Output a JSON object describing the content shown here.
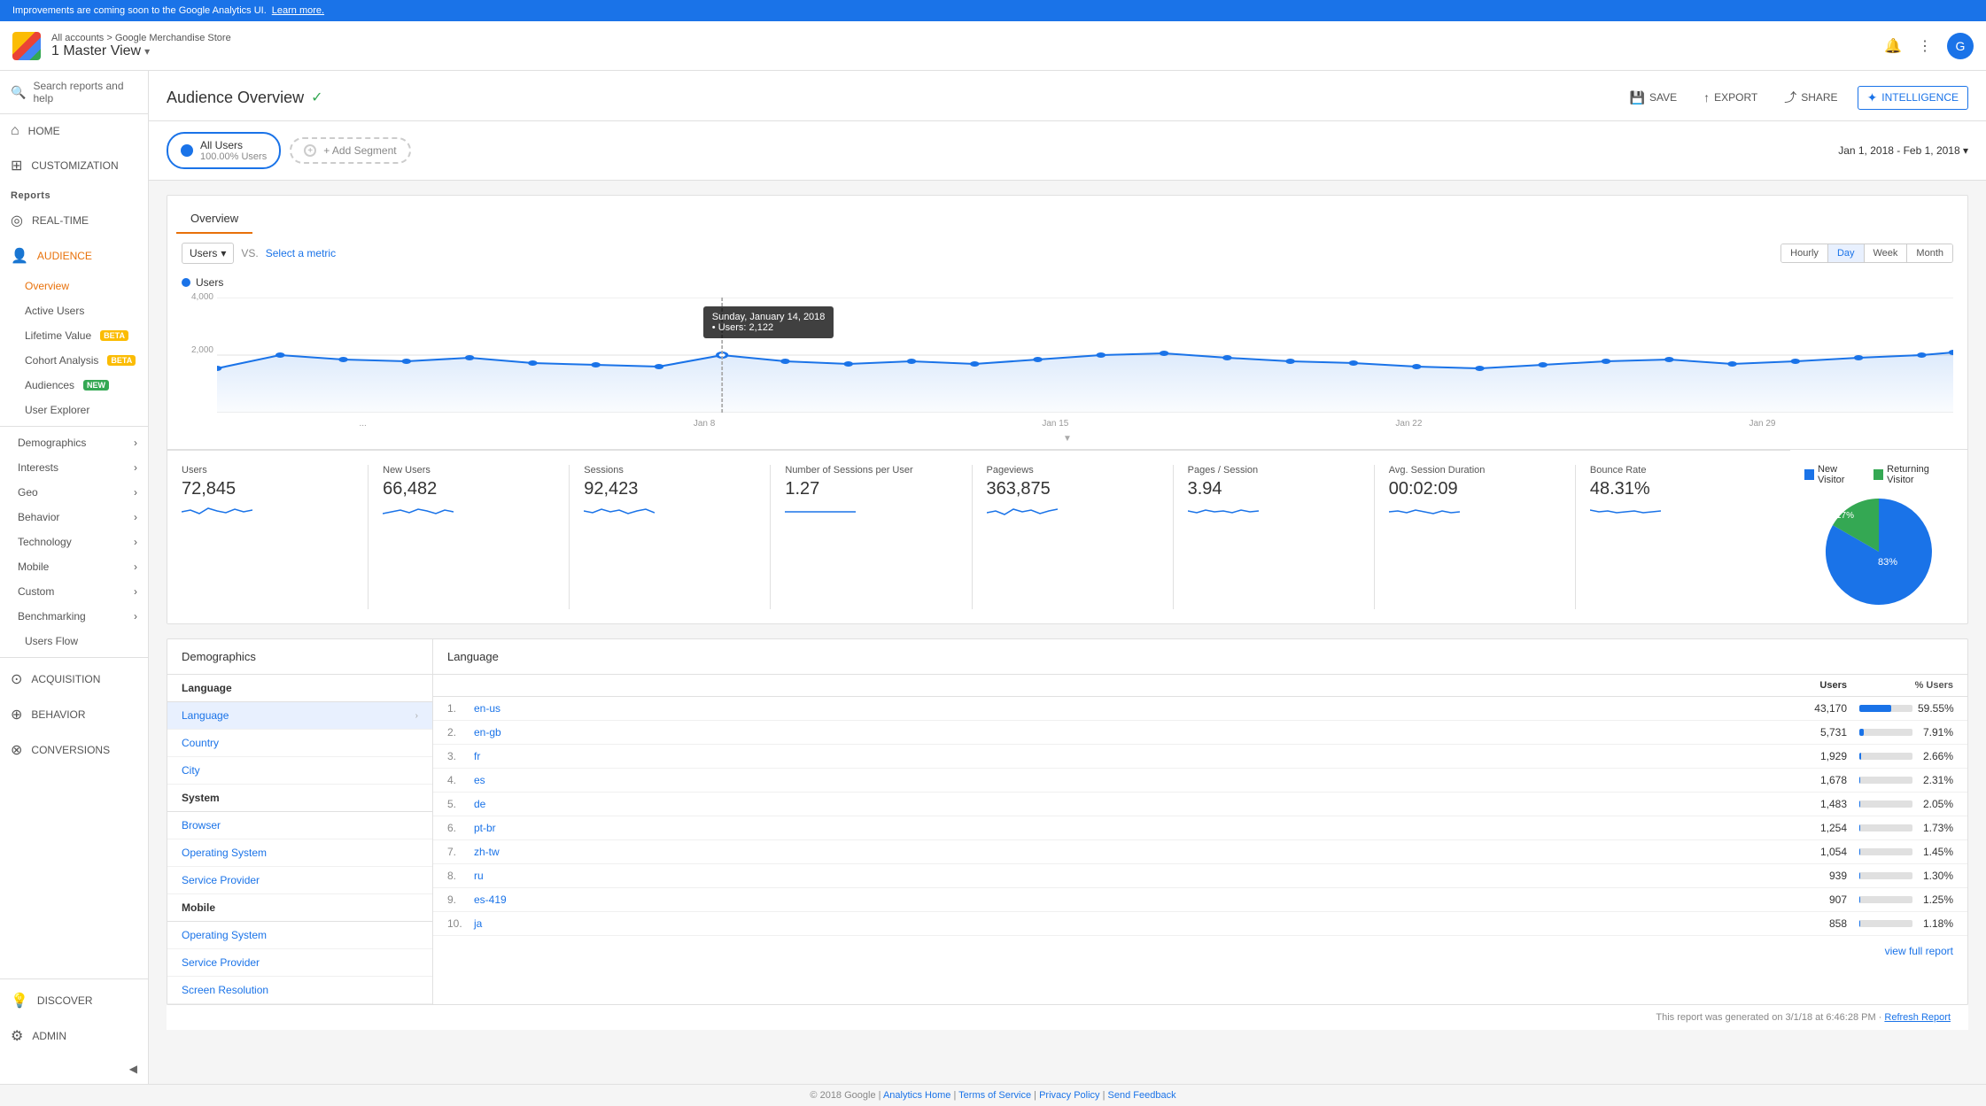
{
  "announcement": {
    "text": "Improvements are coming soon to the Google Analytics UI.",
    "link_text": "Learn more."
  },
  "header": {
    "account_path": "All accounts > Google Merchandise Store",
    "view_name": "1 Master View",
    "chevron": "▾"
  },
  "sidebar": {
    "search_placeholder": "Search reports and help",
    "nav_items": [
      {
        "id": "home",
        "label": "HOME",
        "icon": "⌂"
      },
      {
        "id": "customization",
        "label": "CUSTOMIZATION",
        "icon": "⊞"
      }
    ],
    "reports_label": "Reports",
    "report_nav": [
      {
        "id": "realtime",
        "label": "REAL-TIME",
        "icon": "◎"
      },
      {
        "id": "audience",
        "label": "AUDIENCE",
        "icon": "👤",
        "active": true
      }
    ],
    "audience_sub": [
      {
        "id": "overview",
        "label": "Overview",
        "active": true
      },
      {
        "id": "active-users",
        "label": "Active Users"
      },
      {
        "id": "lifetime-value",
        "label": "Lifetime Value",
        "badge": "BETA"
      },
      {
        "id": "cohort-analysis",
        "label": "Cohort Analysis",
        "badge": "BETA"
      },
      {
        "id": "audiences",
        "label": "Audiences",
        "badge": "NEW"
      },
      {
        "id": "user-explorer",
        "label": "User Explorer"
      }
    ],
    "collapse_items": [
      {
        "id": "demographics",
        "label": "Demographics"
      },
      {
        "id": "interests",
        "label": "Interests"
      },
      {
        "id": "geo",
        "label": "Geo"
      },
      {
        "id": "behavior",
        "label": "Behavior"
      },
      {
        "id": "technology",
        "label": "Technology"
      },
      {
        "id": "mobile",
        "label": "Mobile"
      },
      {
        "id": "custom",
        "label": "Custom"
      },
      {
        "id": "benchmarking",
        "label": "Benchmarking"
      },
      {
        "id": "users-flow",
        "label": "Users Flow"
      }
    ],
    "main_nav": [
      {
        "id": "acquisition",
        "label": "ACQUISITION",
        "icon": "⊙"
      },
      {
        "id": "behavior",
        "label": "BEHAVIOR",
        "icon": "⊕"
      },
      {
        "id": "conversions",
        "label": "CONVERSIONS",
        "icon": "⊗"
      }
    ],
    "bottom_nav": [
      {
        "id": "discover",
        "label": "DISCOVER",
        "icon": "💡"
      },
      {
        "id": "admin",
        "label": "ADMIN",
        "icon": "⚙"
      }
    ],
    "toggle_label": "◀"
  },
  "main": {
    "title": "Audience Overview",
    "verified": "✓",
    "actions": [
      {
        "id": "save",
        "label": "SAVE",
        "icon": "💾"
      },
      {
        "id": "export",
        "label": "EXPORT",
        "icon": "↑"
      },
      {
        "id": "share",
        "label": "SHARE",
        "icon": "⤴"
      },
      {
        "id": "intelligence",
        "label": "INTELLIGENCE",
        "icon": "✦"
      }
    ],
    "segment": {
      "label": "All Users",
      "sub": "100.00% Users"
    },
    "add_segment": "+ Add Segment",
    "date_range": "Jan 1, 2018 - Feb 1, 2018 ▾",
    "overview_tab": "Overview",
    "chart": {
      "metric_label": "Users",
      "vs_text": "VS.",
      "select_metric": "Select a metric",
      "time_buttons": [
        "Hourly",
        "Day",
        "Week",
        "Month"
      ],
      "active_time": "Day",
      "legend_label": "Users",
      "y_max": "4,000",
      "y_mid": "2,000",
      "x_labels": [
        "Jan 8",
        "Jan 15",
        "Jan 22",
        "Jan 29"
      ],
      "tooltip": {
        "date": "Sunday, January 14, 2018",
        "metric": "• Users: 2,122"
      }
    },
    "metrics": [
      {
        "name": "Users",
        "value": "72,845"
      },
      {
        "name": "New Users",
        "value": "66,482"
      },
      {
        "name": "Sessions",
        "value": "92,423"
      },
      {
        "name": "Number of Sessions per User",
        "value": "1.27"
      },
      {
        "name": "Pageviews",
        "value": "363,875"
      },
      {
        "name": "Pages / Session",
        "value": "3.94"
      },
      {
        "name": "Avg. Session Duration",
        "value": "00:02:09"
      },
      {
        "name": "Bounce Rate",
        "value": "48.31%"
      }
    ],
    "pie": {
      "new_visitor_pct": 83,
      "returning_visitor_pct": 17,
      "new_visitor_label": "New Visitor",
      "returning_visitor_label": "Returning Visitor",
      "new_color": "#1a73e8",
      "returning_color": "#34a853",
      "new_pct_text": "83%",
      "returning_pct_text": "17%"
    },
    "demographics": {
      "title": "Demographics",
      "groups": [
        {
          "title": "Language",
          "items": [
            "Language",
            "Country",
            "City"
          ],
          "active": "Language"
        },
        {
          "title": "System",
          "items": [
            "Browser",
            "Operating System",
            "Service Provider"
          ]
        },
        {
          "title": "Mobile",
          "items": [
            "Operating System",
            "Service Provider",
            "Screen Resolution"
          ]
        }
      ]
    },
    "language_table": {
      "title": "Language",
      "col_users": "Users",
      "col_pct": "% Users",
      "rows": [
        {
          "num": "1.",
          "lang": "en-us",
          "users": "43,170",
          "pct": 59.55,
          "pct_text": "59.55%"
        },
        {
          "num": "2.",
          "lang": "en-gb",
          "users": "5,731",
          "pct": 7.91,
          "pct_text": "7.91%"
        },
        {
          "num": "3.",
          "lang": "fr",
          "users": "1,929",
          "pct": 2.66,
          "pct_text": "2.66%"
        },
        {
          "num": "4.",
          "lang": "es",
          "users": "1,678",
          "pct": 2.31,
          "pct_text": "2.31%"
        },
        {
          "num": "5.",
          "lang": "de",
          "users": "1,483",
          "pct": 2.05,
          "pct_text": "2.05%"
        },
        {
          "num": "6.",
          "lang": "pt-br",
          "users": "1,254",
          "pct": 1.73,
          "pct_text": "1.73%"
        },
        {
          "num": "7.",
          "lang": "zh-tw",
          "users": "1,054",
          "pct": 1.45,
          "pct_text": "1.45%"
        },
        {
          "num": "8.",
          "lang": "ru",
          "users": "939",
          "pct": 1.3,
          "pct_text": "1.30%"
        },
        {
          "num": "9.",
          "lang": "es-419",
          "users": "907",
          "pct": 1.25,
          "pct_text": "1.25%"
        },
        {
          "num": "10.",
          "lang": "ja",
          "users": "858",
          "pct": 1.18,
          "pct_text": "1.18%"
        }
      ],
      "view_full_link": "view full report"
    },
    "report_generated": "This report was generated on 3/1/18 at 6:46:28 PM ·",
    "refresh_link": "Refresh Report"
  },
  "footer": {
    "copyright": "© 2018 Google",
    "links": [
      "Analytics Home",
      "Terms of Service",
      "Privacy Policy",
      "Send Feedback"
    ]
  }
}
